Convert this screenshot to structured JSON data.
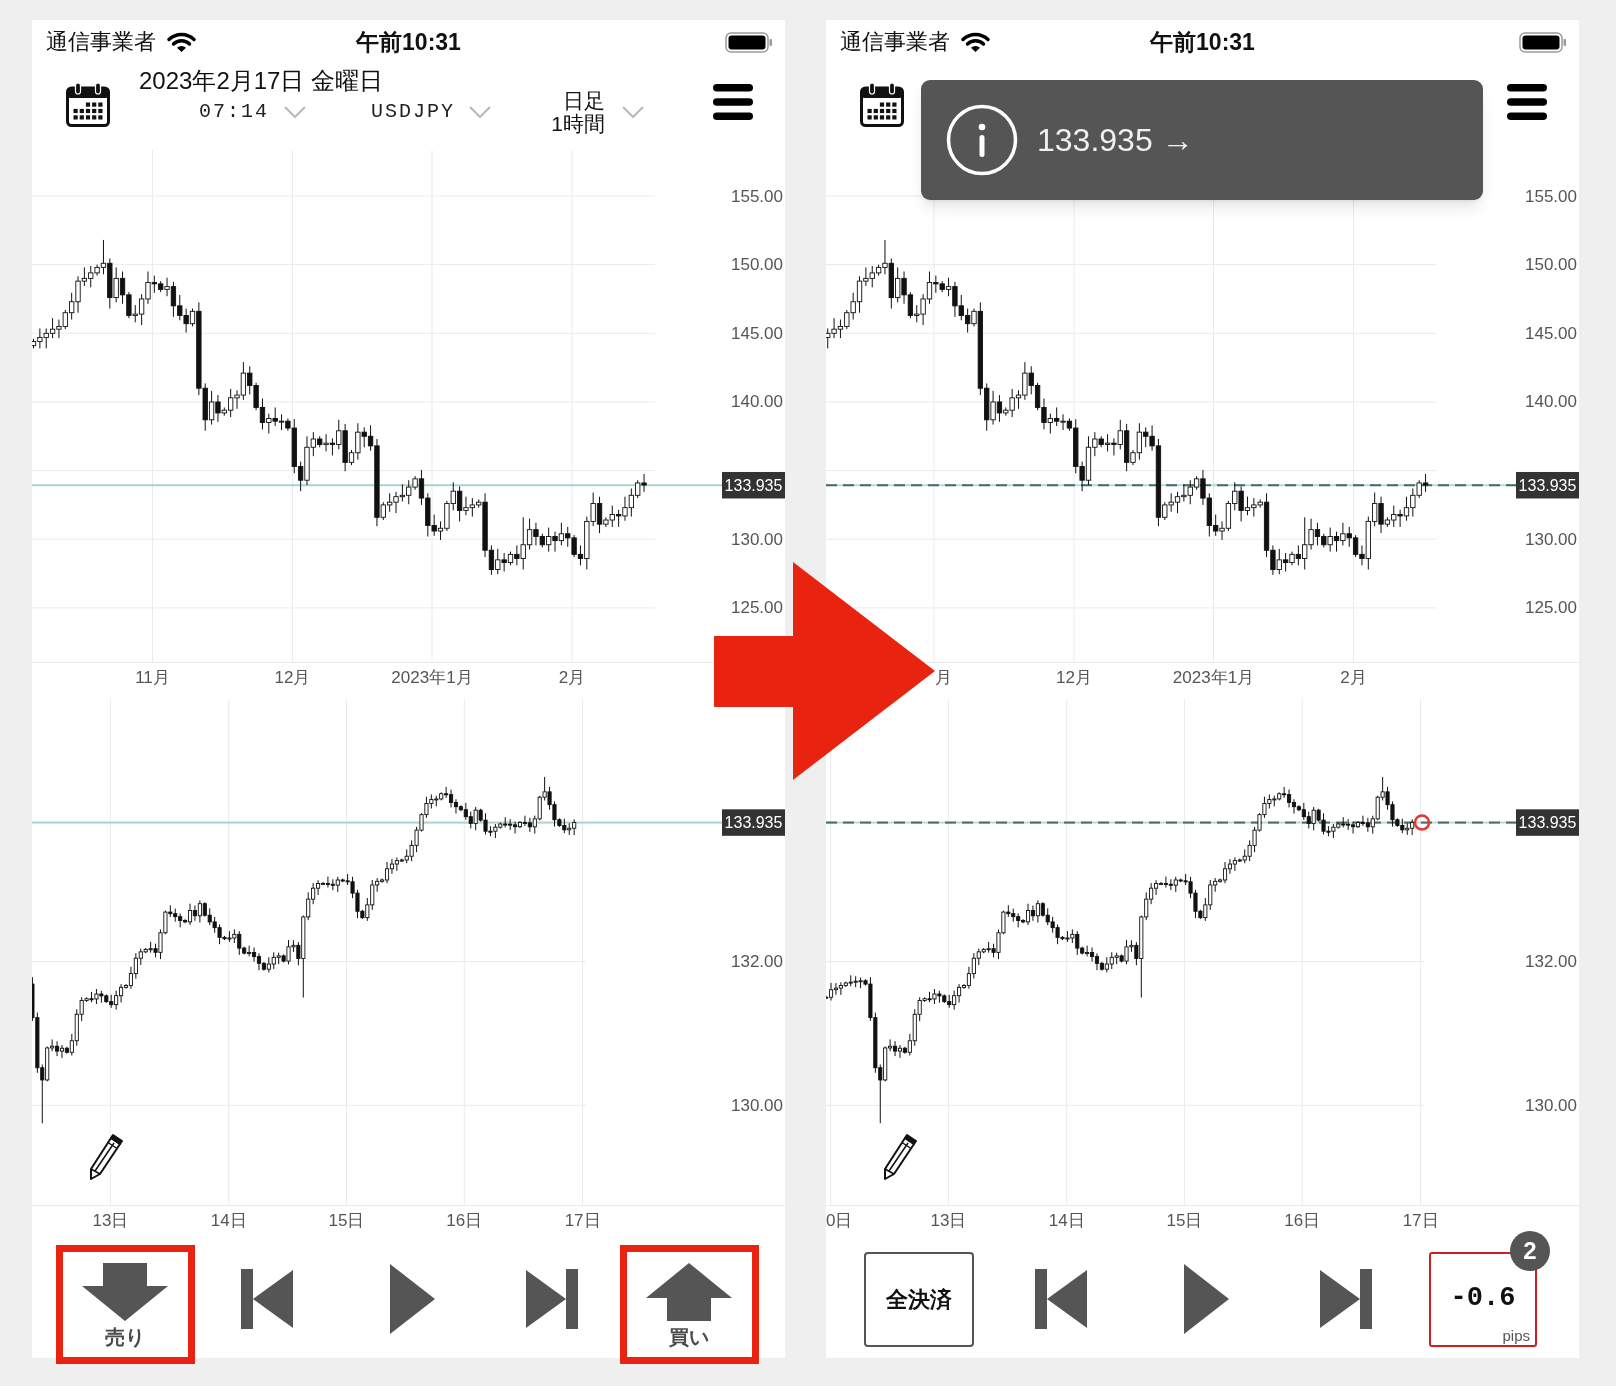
{
  "screens": [
    {
      "status_bar": {
        "carrier": "通信事業者",
        "time": "午前10:31"
      },
      "header": {
        "date": "2023年2月17日 金曜日",
        "time_select": "07:14",
        "symbol_select": "USDJPY",
        "timeframe_select": [
          "日足",
          "1時間"
        ]
      },
      "upper_chart": {
        "y_labels": [
          "155.00",
          "150.00",
          "145.00",
          "140.00",
          "130.00",
          "125.00"
        ],
        "price_tag": "133.935",
        "dashed_price_line": false,
        "x_labels": [
          "11月",
          "12月",
          "2023年1月",
          "2月"
        ]
      },
      "lower_chart": {
        "y_labels": [
          "132.00",
          "130.00"
        ],
        "price_tag": "133.935",
        "dashed_price_line": false,
        "x_labels": [
          "13日",
          "14日",
          "15日",
          "16日",
          "17日"
        ]
      },
      "controls": [
        {
          "kind": "sell",
          "label": "売り",
          "highlighted": true
        },
        {
          "kind": "skip_back",
          "highlighted": false
        },
        {
          "kind": "play",
          "highlighted": false
        },
        {
          "kind": "skip_forward",
          "highlighted": false
        },
        {
          "kind": "buy",
          "label": "買い",
          "highlighted": true
        }
      ]
    },
    {
      "status_bar": {
        "carrier": "通信事業者",
        "time": "午前10:31"
      },
      "toast": {
        "text": "133.935 →"
      },
      "upper_chart": {
        "y_labels": [
          "155.00",
          "150.00",
          "145.00",
          "140.00",
          "130.00",
          "125.00"
        ],
        "price_tag": "133.935",
        "dashed_price_line": true,
        "x_labels": [
          "月",
          "12月",
          "2023年1月",
          "2月"
        ]
      },
      "lower_chart": {
        "y_labels": [
          "132.00",
          "130.00"
        ],
        "price_tag": "133.935",
        "dashed_price_line": true,
        "position_marker": true,
        "x_labels": [
          "0日",
          "13日",
          "14日",
          "15日",
          "16日",
          "17日"
        ]
      },
      "controls": [
        {
          "kind": "close_all",
          "label": "全決済",
          "highlighted": false
        },
        {
          "kind": "skip_back",
          "highlighted": false
        },
        {
          "kind": "play",
          "highlighted": false
        },
        {
          "kind": "skip_forward",
          "highlighted": false
        },
        {
          "kind": "pips",
          "value": "-0.6",
          "unit": "pips",
          "badge": "2",
          "highlighted": false
        }
      ]
    }
  ]
}
